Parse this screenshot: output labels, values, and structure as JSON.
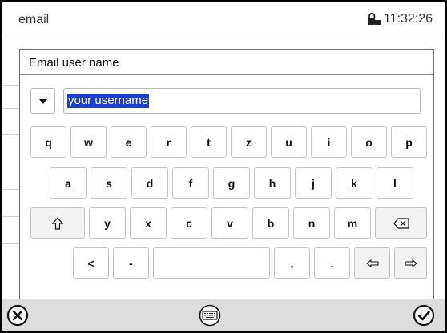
{
  "titlebar": {
    "title": "email",
    "time": "11:32:26",
    "lock_icon": "lock-icon"
  },
  "dialog": {
    "title": "Email user name",
    "input_value": "your username"
  },
  "keyboard": {
    "row1": [
      "q",
      "w",
      "e",
      "r",
      "t",
      "z",
      "u",
      "i",
      "o",
      "p"
    ],
    "row2": [
      "a",
      "s",
      "d",
      "f",
      "g",
      "h",
      "j",
      "k",
      "l"
    ],
    "row3": [
      "y",
      "x",
      "c",
      "v",
      "b",
      "n",
      "m"
    ],
    "row4": [
      "<",
      "-",
      ",",
      "."
    ]
  },
  "icons": {
    "shift": "shift-icon",
    "backspace": "backspace-icon",
    "left": "arrow-left-icon",
    "right": "arrow-right-icon",
    "cancel": "close-icon",
    "keyboard": "keyboard-icon",
    "confirm": "checkmark-icon"
  }
}
